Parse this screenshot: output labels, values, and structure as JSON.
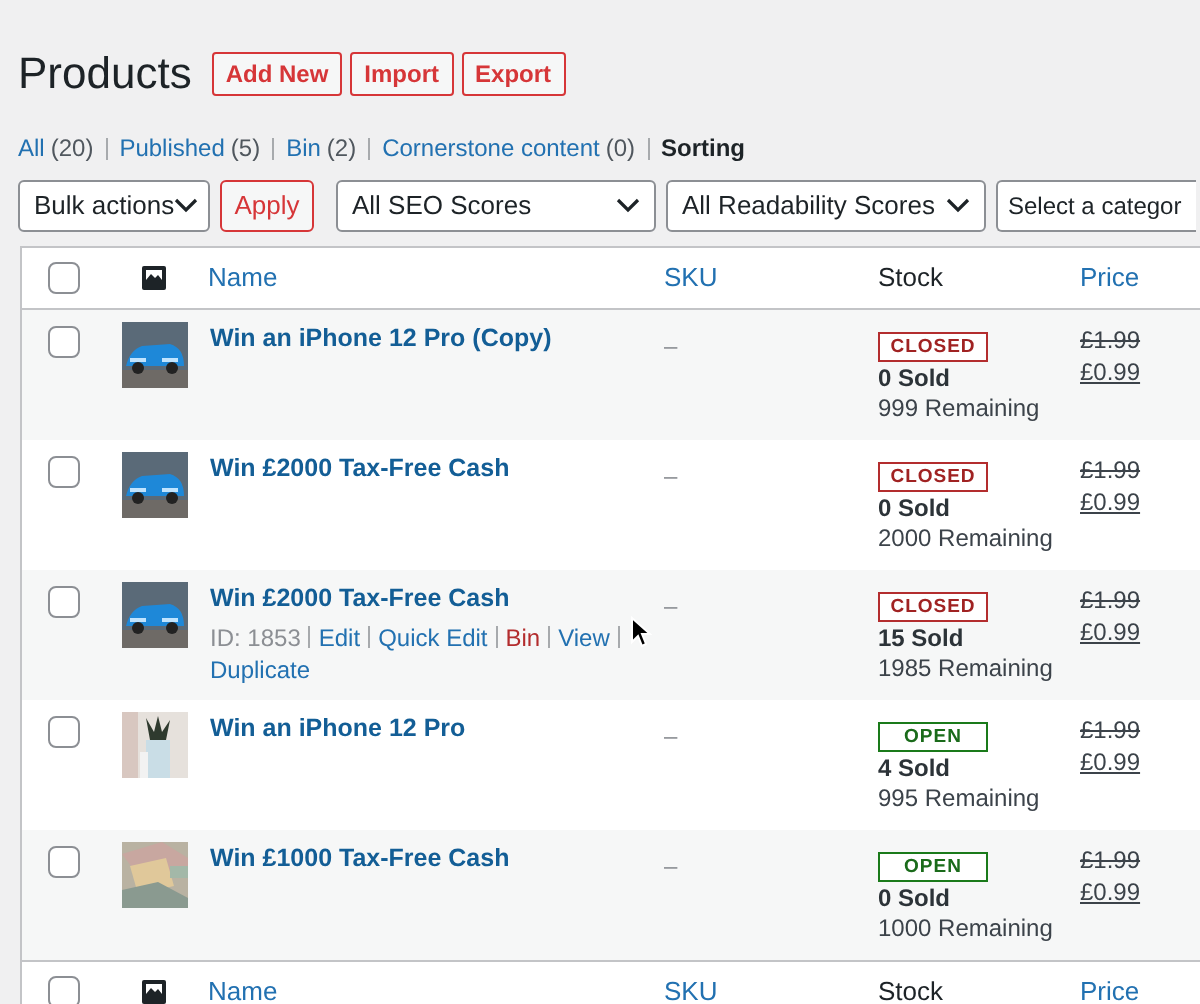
{
  "page_title": "Products",
  "header_buttons": [
    "Add New",
    "Import",
    "Export"
  ],
  "filters": [
    {
      "label": "All",
      "count": "(20)",
      "selected": false
    },
    {
      "label": "Published",
      "count": "(5)",
      "selected": false
    },
    {
      "label": "Bin",
      "count": "(2)",
      "selected": false
    },
    {
      "label": "Cornerstone content",
      "count": "(0)",
      "selected": false
    },
    {
      "label": "Sorting",
      "selected": true
    }
  ],
  "bulk_actions": "Bulk actions",
  "apply_button": "Apply",
  "dropdowns": [
    "All SEO Scores",
    "All Readability Scores",
    "Select a categor"
  ],
  "table": {
    "header": {
      "checked": false,
      "columns": [
        "Name",
        "SKU",
        "Stock",
        "Price"
      ]
    },
    "rows": [
      {
        "checked": false,
        "name": "Win an iPhone 12 Pro (Copy)",
        "sku": "–",
        "status": "CLOSED",
        "kind": "closed",
        "sold": "0 Sold",
        "remaining": "999 Remaining",
        "old_price": "£1.99",
        "price": "£0.99"
      },
      {
        "checked": false,
        "name": "Win £2000 Tax-Free Cash",
        "sku": "–",
        "status": "CLOSED",
        "kind": "closed",
        "sold": "0 Sold",
        "remaining": "2000 Remaining",
        "old_price": "£1.99",
        "price": "£0.99"
      },
      {
        "checked": false,
        "name": "Win £2000 Tax-Free Cash",
        "sku": "–",
        "status": "CLOSED",
        "kind": "closed",
        "sold": "15 Sold",
        "remaining": "1985 Remaining",
        "old_price": "£1.99",
        "price": "£0.99",
        "row_actions": {
          "id": "ID: 1853",
          "links": [
            {
              "label": "Edit",
              "kind": "normal"
            },
            {
              "label": "Quick Edit",
              "kind": "normal"
            },
            {
              "label": "Bin",
              "kind": "danger"
            },
            {
              "label": "View",
              "kind": "normal"
            },
            {
              "label": "Duplicate",
              "kind": "normal"
            }
          ]
        }
      },
      {
        "checked": false,
        "name": "Win an iPhone 12 Pro",
        "sku": "–",
        "status": "OPEN",
        "kind": "open",
        "sold": "4 Sold",
        "remaining": "995 Remaining",
        "old_price": "£1.99",
        "price": "£0.99"
      },
      {
        "checked": false,
        "name": "Win £1000 Tax-Free Cash",
        "sku": "–",
        "status": "OPEN",
        "kind": "open",
        "sold": "0 Sold",
        "remaining": "1000 Remaining",
        "old_price": "£1.99",
        "price": "£0.99"
      }
    ],
    "footer": {
      "checked": false,
      "columns": [
        "Name",
        "SKU",
        "Stock",
        "Price"
      ]
    }
  }
}
